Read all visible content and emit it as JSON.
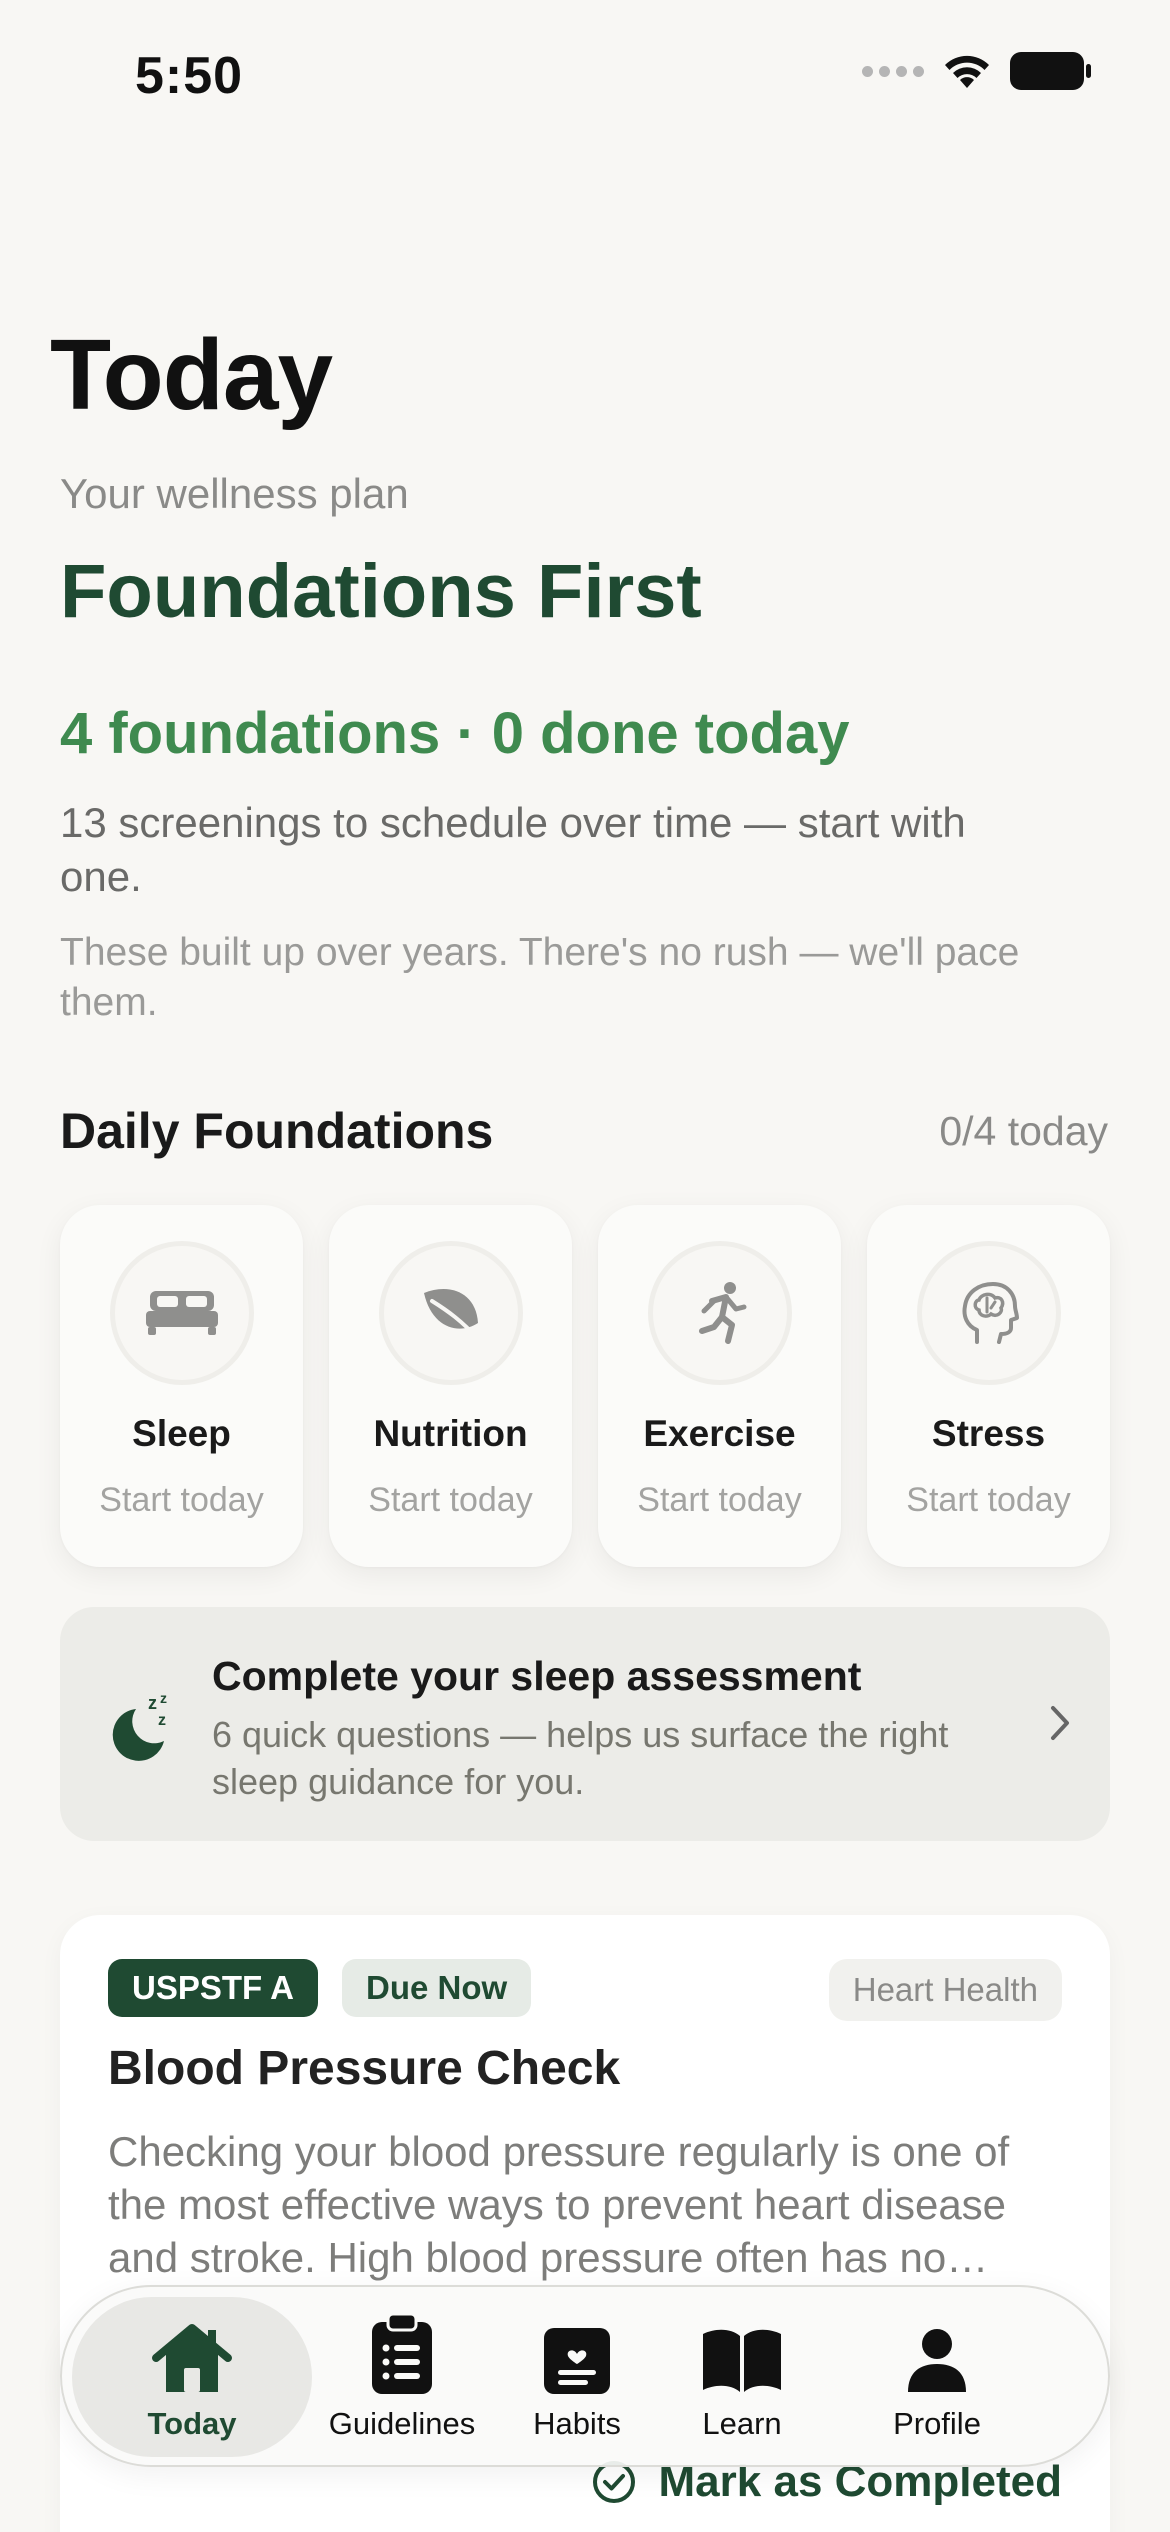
{
  "status_bar": {
    "time": "5:50"
  },
  "header": {
    "title": "Today",
    "plan_label": "Your wellness plan",
    "plan_name": "Foundations First",
    "progress": "4 foundations · 0 done today",
    "screenings": "13 screenings to schedule over time — start with one.",
    "pace": "These built up over years. There's no rush — we'll pace them."
  },
  "daily": {
    "title": "Daily Foundations",
    "count": "0/4 today",
    "items": [
      {
        "name": "Sleep",
        "status": "Start today",
        "icon": "bed-icon"
      },
      {
        "name": "Nutrition",
        "status": "Start today",
        "icon": "leaf-icon"
      },
      {
        "name": "Exercise",
        "status": "Start today",
        "icon": "running-icon"
      },
      {
        "name": "Stress",
        "status": "Start today",
        "icon": "brain-icon"
      }
    ]
  },
  "assessment": {
    "title": "Complete your sleep assessment",
    "description": "6 quick questions — helps us surface the right sleep guidance for you.",
    "icon": "moon-zzz-icon"
  },
  "recommendation": {
    "grade": "USPSTF A",
    "due": "Due Now",
    "category": "Heart Health",
    "title": "Blood Pressure Check",
    "description": "Checking your blood pressure regularly is one of the most effective ways to prevent heart disease and stroke. High blood pressure often has no symptoms.",
    "action": "Mark as Completed"
  },
  "tabbar": {
    "tabs": [
      {
        "label": "Today",
        "icon": "house-icon",
        "active": true
      },
      {
        "label": "Guidelines",
        "icon": "clipboard-icon",
        "active": false
      },
      {
        "label": "Habits",
        "icon": "journal-icon",
        "active": false
      },
      {
        "label": "Learn",
        "icon": "book-icon",
        "active": false
      },
      {
        "label": "Profile",
        "icon": "person-icon",
        "active": false
      }
    ]
  },
  "colors": {
    "brand": "#1f4a32",
    "accent": "#3f8a4f",
    "background": "#f8f7f4"
  }
}
